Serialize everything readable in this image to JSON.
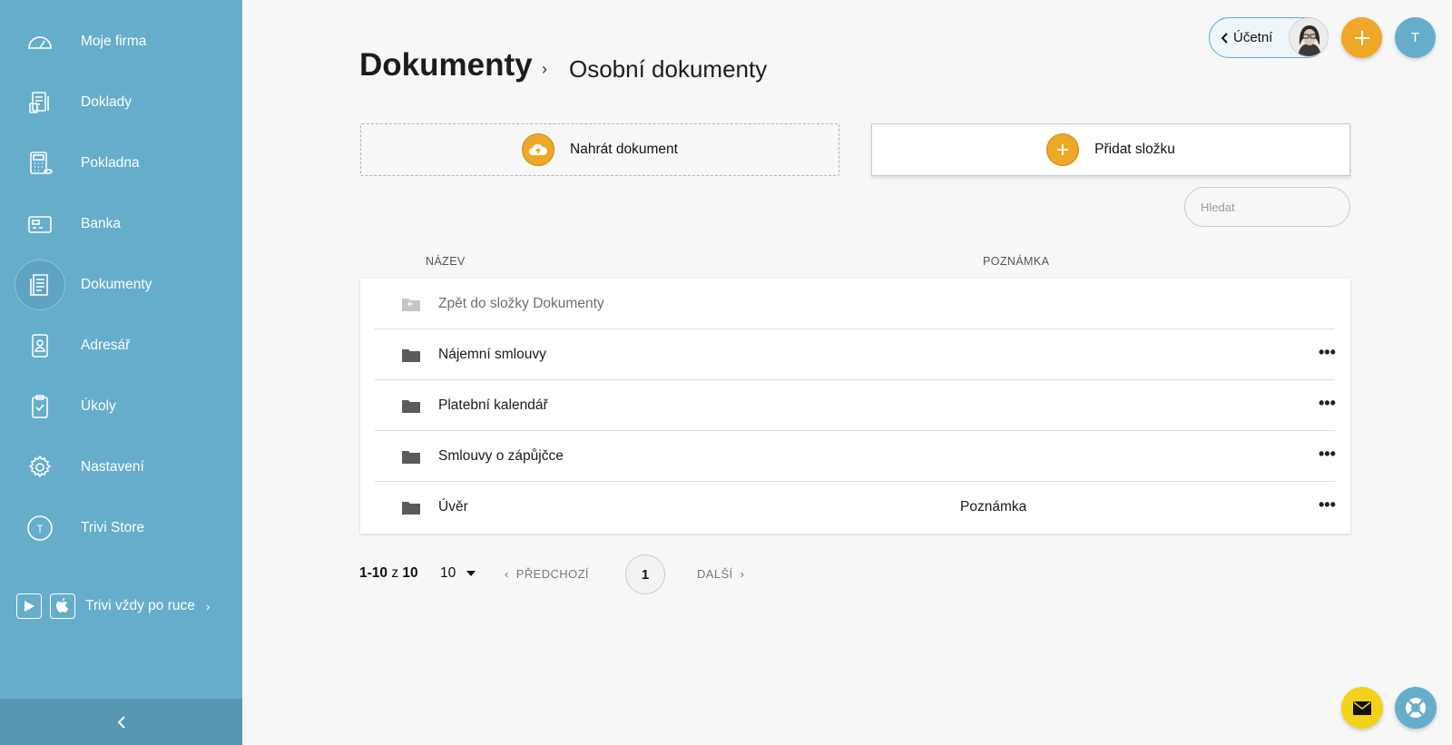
{
  "sidebar": {
    "items": [
      {
        "label": "Moje firma",
        "icon": "dashboard-gauge-icon"
      },
      {
        "label": "Doklady",
        "icon": "receipt-icon"
      },
      {
        "label": "Pokladna",
        "icon": "calculator-icon"
      },
      {
        "label": "Banka",
        "icon": "bank-card-icon"
      },
      {
        "label": "Dokumenty",
        "icon": "documents-icon",
        "active": true
      },
      {
        "label": "Adresář",
        "icon": "contact-card-icon"
      },
      {
        "label": "Úkoly",
        "icon": "clipboard-check-icon"
      },
      {
        "label": "Nastavení",
        "icon": "gear-icon"
      },
      {
        "label": "Trivi Store",
        "icon": "trivi-store-icon",
        "badge": "T"
      }
    ],
    "mobile_promo": "Trivi vždy po ruce",
    "colors": {
      "background": "#66adcb",
      "footer": "#5897b2"
    }
  },
  "header": {
    "title": "Dokumenty",
    "breadcrumb_current": "Osobní dokumenty",
    "accountant_label": "Účetní",
    "user_initial": "T"
  },
  "actions": {
    "upload_label": "Nahrát dokument",
    "add_folder_label": "Přidat složku",
    "search_placeholder": "Hledat",
    "accent": "#eea726"
  },
  "table": {
    "columns": [
      "NÁZEV",
      "POZNÁMKA"
    ],
    "back_row": "Zpět do složky Dokumenty",
    "rows": [
      {
        "name": "Nájemní smlouvy",
        "note": ""
      },
      {
        "name": "Platební kalendář",
        "note": ""
      },
      {
        "name": "Smlouvy o zápůjčce",
        "note": ""
      },
      {
        "name": "Úvěr",
        "note": "Poznámka"
      }
    ]
  },
  "pagination": {
    "range": "1-10",
    "of": "z",
    "total": "10",
    "page_size": "10",
    "prev_label": "PŘEDCHOZÍ",
    "next_label": "DALŠÍ",
    "current_page": "1"
  }
}
